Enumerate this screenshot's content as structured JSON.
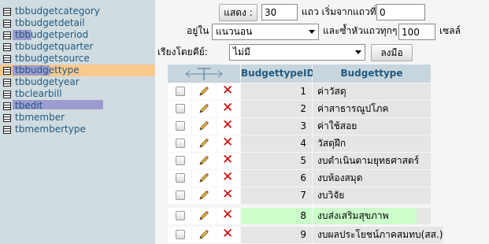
{
  "nav": {
    "tables": [
      {
        "label": "tbbudgetcategory"
      },
      {
        "label": "tbbudgetdetail"
      },
      {
        "label": "tbbudgetperiod"
      },
      {
        "label": "tbbudgetquarter"
      },
      {
        "label": "tbbudgetsource"
      },
      {
        "label": "tbbudgettype"
      },
      {
        "label": "tbbudgetyear"
      },
      {
        "label": "tbclearbill"
      },
      {
        "label": "tbedit"
      },
      {
        "label": "tbmember"
      },
      {
        "label": "tbmembertype"
      }
    ],
    "selected": "tbbudgettype"
  },
  "controls": {
    "show_button": "แสดง :",
    "rows_value": "30",
    "start_label": "แถว เริ่มจากแถวที่",
    "start_value": "0",
    "in_label": "อยู่ใน",
    "mode_value": "แนวนอน",
    "repeat_label": "และซ้ำหัวแถวทุกๆ",
    "repeat_value": "100",
    "cells_label": "เซลล์",
    "sort_label": "เรียงโดยคีย์:",
    "sort_value": "ไม่มี",
    "go_button": "ลงมือ"
  },
  "grid": {
    "columns": [
      "BudgettypeID",
      "Budgettype"
    ],
    "rows": [
      {
        "id": "1",
        "name": "ค่าวัสดุ"
      },
      {
        "id": "2",
        "name": "ค่าสาธารณูปโภค"
      },
      {
        "id": "3",
        "name": "ค่าใช้สอย"
      },
      {
        "id": "4",
        "name": "วัสดุฝึก"
      },
      {
        "id": "5",
        "name": "งบดำเนินตามยุทธศาสตร์"
      },
      {
        "id": "6",
        "name": "งบห้องสมุด"
      },
      {
        "id": "7",
        "name": "งบวิจัย"
      },
      {
        "id": "8",
        "name": "งบส่งเสริมสุขภาพ"
      },
      {
        "id": "9",
        "name": "งบผลประโยชน์ภาคสมทบ(สส.)"
      }
    ],
    "highlighted_row": 8
  },
  "colors": {
    "nav_bg": "#d0dce0",
    "link": "#235a81",
    "selected_row": "#f7c98d",
    "marker": "#9c9cd0",
    "header": "#c7d6dd",
    "highlight": "#ccffcc",
    "delete": "#cc0000"
  }
}
